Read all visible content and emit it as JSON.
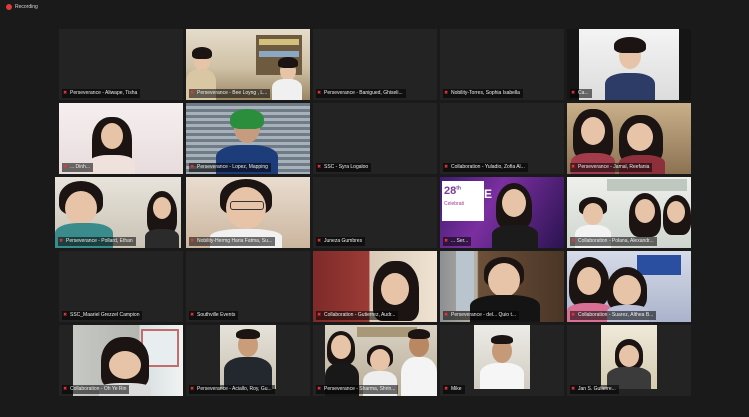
{
  "recording": {
    "label": "Recording"
  },
  "participants": [
    "Perseverance - Aliwape, Tisha",
    "Perseverance - Bee Loyng , L...",
    "Perseverance - Banigued, Ghiseli...",
    "Nobility-Torres, Sophia Isabella",
    "Ca...",
    "... Dinh...",
    "Perseverance - Lopez, Mapping",
    "SSC - Syra Logaloo",
    "Collaboration - Yuladio, Zofia Al...",
    "Perseverance - Jamal, Reefania",
    "Perseverance - Pollard, Ethan",
    "Nobility-Hermg Haria Fatma, Su...",
    "Juneza Gumbres",
    "... Ser...",
    "Collaboration - Polana, Alexandr...",
    "SSC_Maariel Grezzel Campion",
    "Southville Events",
    "Collaboration - Gutierrez, Audr...",
    "Perseverance - del... Quio t...",
    "Collaboration - Suarez, Althea B...",
    "Collaboration - Oh Ye Rin",
    "Perseverance - Aciallo, Roy, Gu...",
    "Perseverance - Sharma, Shrin...",
    "Mike",
    "Jan S. Gutierre..."
  ],
  "banner": {
    "number": "28",
    "superscript": "th",
    "word": "Celebrati",
    "letter": "E"
  },
  "colors": {
    "background": "#1a1a1a",
    "tile": "#232323",
    "muted_icon": "#e33"
  }
}
